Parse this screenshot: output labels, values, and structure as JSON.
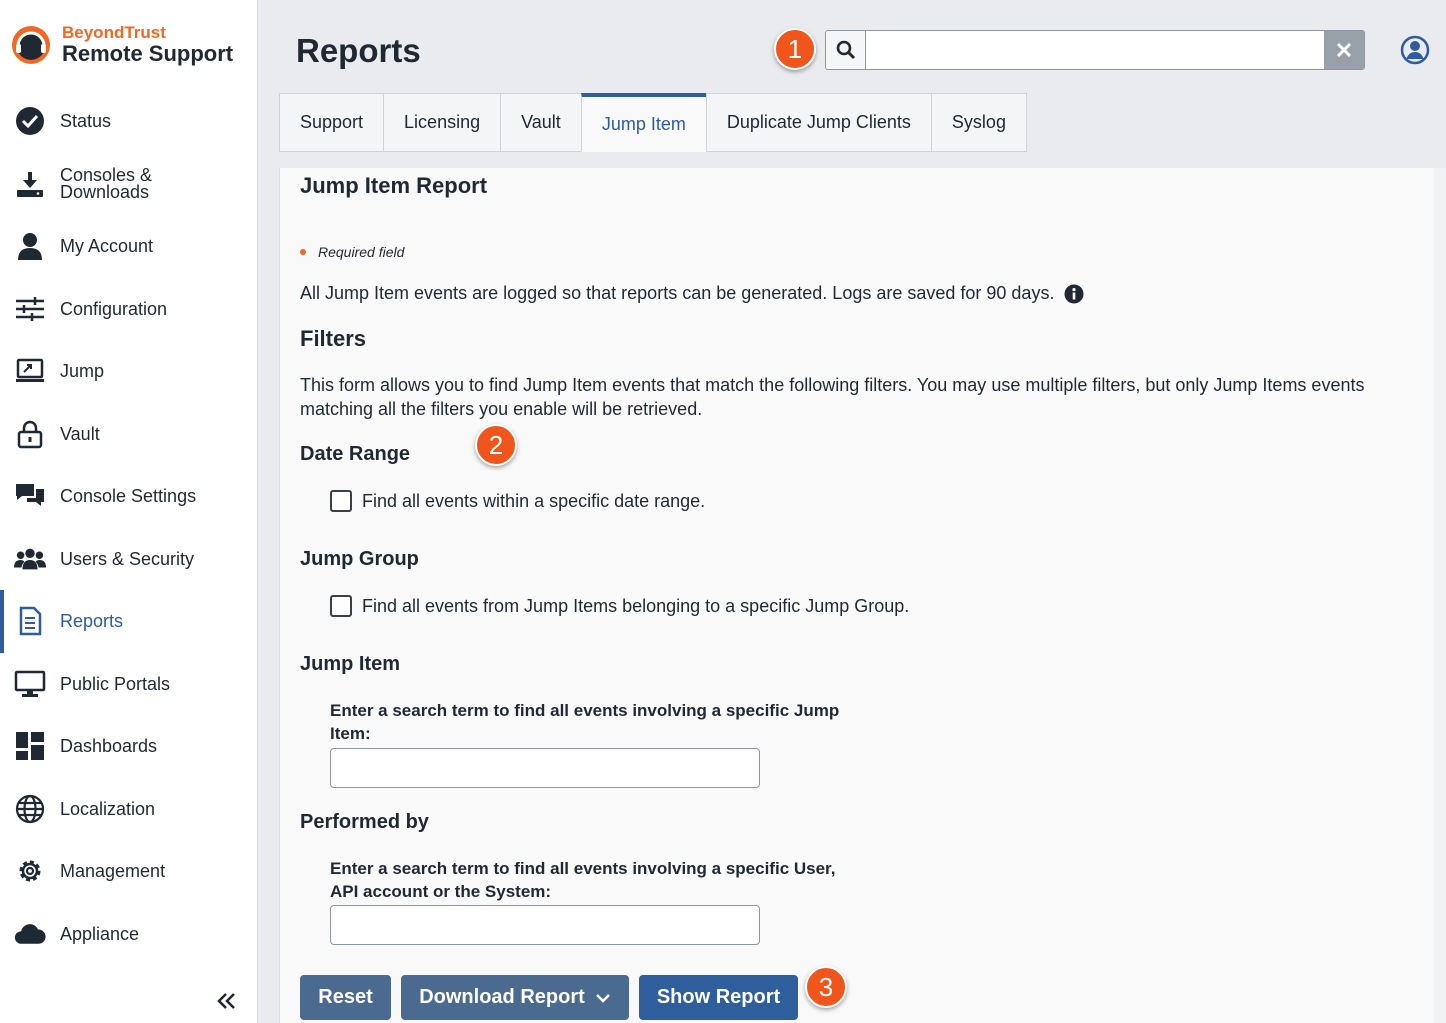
{
  "brand": {
    "top": "BeyondTrust",
    "bottom": "Remote Support"
  },
  "nav": [
    {
      "label": "Status",
      "icon": "check-circle-icon"
    },
    {
      "label": "Consoles &\nDownloads",
      "icon": "download-icon"
    },
    {
      "label": "My Account",
      "icon": "user-icon"
    },
    {
      "label": "Configuration",
      "icon": "sliders-icon"
    },
    {
      "label": "Jump",
      "icon": "jump-icon"
    },
    {
      "label": "Vault",
      "icon": "lock-icon"
    },
    {
      "label": "Console Settings",
      "icon": "chat-bubbles-icon"
    },
    {
      "label": "Users & Security",
      "icon": "users-icon"
    },
    {
      "label": "Reports",
      "icon": "report-icon",
      "active": true
    },
    {
      "label": "Public Portals",
      "icon": "monitor-icon"
    },
    {
      "label": "Dashboards",
      "icon": "dashboard-icon"
    },
    {
      "label": "Localization",
      "icon": "globe-icon"
    },
    {
      "label": "Management",
      "icon": "gear-icon"
    },
    {
      "label": "Appliance",
      "icon": "cloud-icon"
    }
  ],
  "header": {
    "title": "Reports",
    "search_value": ""
  },
  "tabs": [
    "Support",
    "Licensing",
    "Vault",
    "Jump Item",
    "Duplicate Jump Clients",
    "Syslog"
  ],
  "active_tab": "Jump Item",
  "badges": [
    "1",
    "2",
    "3"
  ],
  "report": {
    "title": "Jump Item Report",
    "required": "Required field",
    "intro": "All Jump Item events are logged so that reports can be generated. Logs are saved for 90 days.",
    "filters_title": "Filters",
    "filters_desc": "This form allows you to find Jump Item events that match the following filters. You may use multiple filters, but only Jump Items events matching all the filters you enable will be retrieved.",
    "date_range": {
      "title": "Date Range",
      "checkbox": "Find all events within a specific date range."
    },
    "jump_group": {
      "title": "Jump Group",
      "checkbox": "Find all events from Jump Items belonging to a specific Jump Group."
    },
    "jump_item": {
      "title": "Jump Item",
      "label": "Enter a search term to find all events involving a specific Jump Item:",
      "value": ""
    },
    "performed_by": {
      "title": "Performed by",
      "label": "Enter a search term to find all events involving a specific User, API account or the System:",
      "value": ""
    }
  },
  "buttons": {
    "reset": "Reset",
    "download": "Download Report",
    "show": "Show Report"
  },
  "colors": {
    "accent": "#2e5c9e",
    "brand": "#f26722",
    "badge": "#f0561c"
  }
}
